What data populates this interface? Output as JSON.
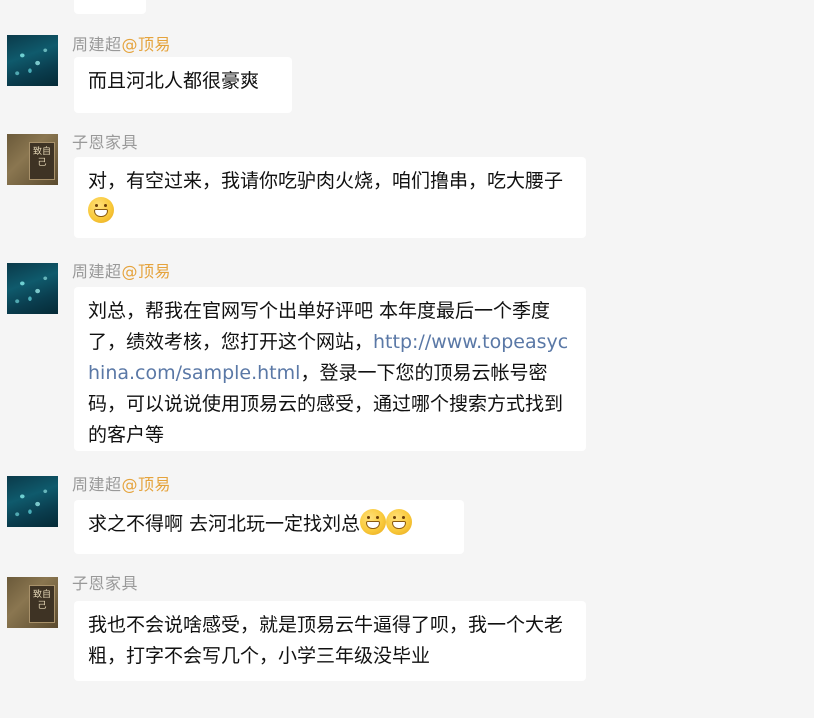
{
  "messages": [
    {
      "sender": "周建超",
      "org": "@顶易",
      "avatar": "fish-avatar",
      "text_parts": [
        "而且河北人都很豪爽"
      ]
    },
    {
      "sender": "子恩家具",
      "org": "",
      "avatar": "book-avatar",
      "avatar_text": "致自己",
      "text_parts": [
        "对，有空过来，我请你吃驴肉火烧，咱们撸串，吃大腰子"
      ],
      "emoji": [
        "grin-emoji"
      ]
    },
    {
      "sender": "周建超",
      "org": "@顶易",
      "avatar": "fish-avatar",
      "text_before": "刘总，帮我在官网写个出单好评吧  本年度最后一个季度了，绩效考核，您打开这个网站，",
      "link": "http://www.topeasychina.com/sample.html",
      "text_after": "，登录一下您的顶易云帐号密码，可以说说使用顶易云的感受，通过哪个搜索方式找到的客户等"
    },
    {
      "sender": "周建超",
      "org": "@顶易",
      "avatar": "fish-avatar",
      "text_parts": [
        "求之不得啊 去河北玩一定找刘总"
      ],
      "emoji": [
        "grin-emoji",
        "grin-emoji"
      ]
    },
    {
      "sender": "子恩家具",
      "org": "",
      "avatar": "book-avatar",
      "avatar_text": "致自己",
      "text_parts": [
        "我也不会说啥感受，就是顶易云牛逼得了呗，我一个大老粗，打字不会写几个，小学三年级没毕业"
      ]
    }
  ],
  "colors": {
    "background": "#f5f5f5",
    "bubble": "#ffffff",
    "sender": "#999999",
    "org_tag": "#e5a33c",
    "link": "#5a78a6"
  }
}
